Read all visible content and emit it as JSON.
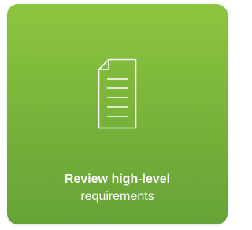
{
  "card": {
    "icon": "document-icon",
    "title": "Review high-level",
    "subtitle": "requirements",
    "colors": {
      "gradient_top": "#8cc63f",
      "gradient_bottom": "#66a338",
      "text": "#ffffff"
    }
  }
}
